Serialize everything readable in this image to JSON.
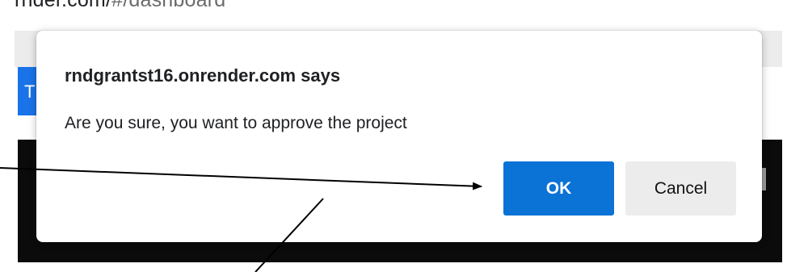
{
  "browser": {
    "url_host": "rnder.com/",
    "url_path": "#/dashboard"
  },
  "page": {
    "blue_button_partial": "T"
  },
  "dialog": {
    "title": "rndgrantst16.onrender.com says",
    "message": "Are you sure, you want to approve the project",
    "ok_label": "OK",
    "cancel_label": "Cancel"
  },
  "colors": {
    "ok_button": "#0b72d6",
    "cancel_button": "#ececec",
    "page_dark_band": "#0b0b0b",
    "page_blue_button": "#1a73e8"
  }
}
